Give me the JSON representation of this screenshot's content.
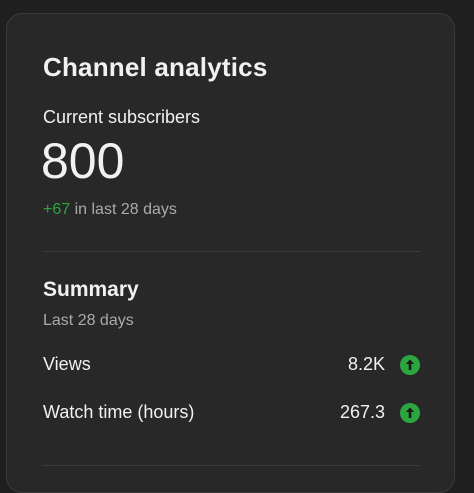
{
  "card": {
    "title": "Channel analytics",
    "subscribers": {
      "label": "Current subscribers",
      "count": "800",
      "delta": "+67",
      "delta_suffix": " in last 28 days"
    },
    "summary": {
      "title": "Summary",
      "period": "Last 28 days",
      "metrics": [
        {
          "label": "Views",
          "value": "8.2K",
          "trend": "up-arrow-icon"
        },
        {
          "label": "Watch time (hours)",
          "value": "267.3",
          "trend": "up-arrow-icon"
        }
      ]
    }
  },
  "colors": {
    "background": "#1f1f1f",
    "card": "#282828",
    "text": "#f1f1f1",
    "secondary_text": "#aaaaaa",
    "positive": "#2ba640"
  }
}
